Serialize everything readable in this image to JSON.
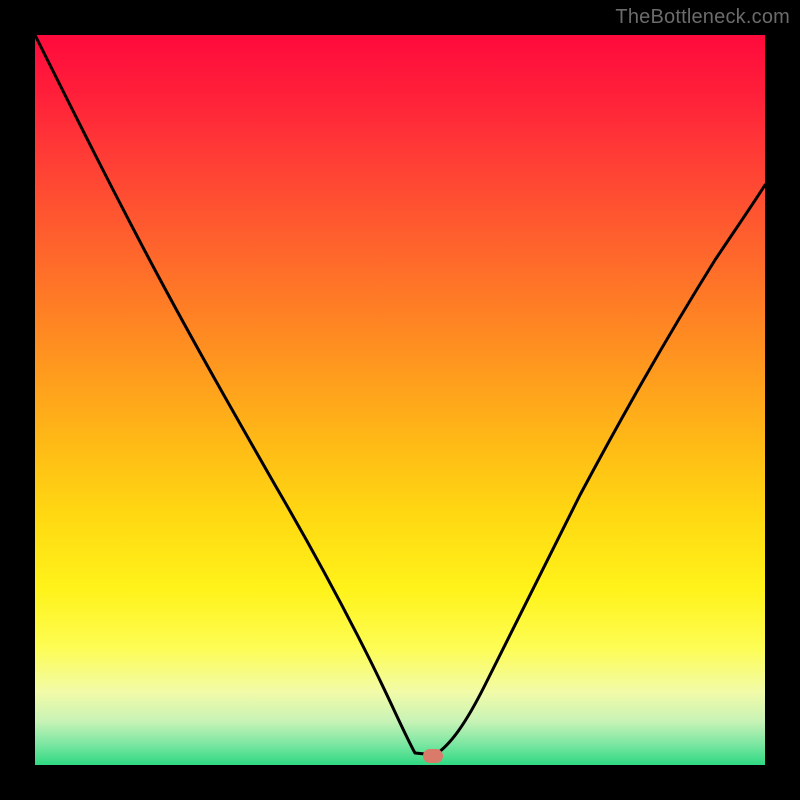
{
  "watermark": "TheBottleneck.com",
  "chart_data": {
    "type": "line",
    "title": "",
    "xlabel": "",
    "ylabel": "",
    "xlim": [
      0,
      100
    ],
    "ylim": [
      0,
      100
    ],
    "background_gradient": {
      "top": "#ff0a3c",
      "bottom": "#2fd983",
      "meaning": "severity scale (red=high, green=low)"
    },
    "series": [
      {
        "name": "bottleneck-curve",
        "color": "#000000",
        "x": [
          0,
          5,
          10,
          15,
          20,
          25,
          30,
          35,
          40,
          45,
          48,
          50,
          52,
          55,
          58,
          62,
          68,
          74,
          80,
          86,
          92,
          100
        ],
        "y": [
          100,
          88,
          77,
          66,
          56,
          46,
          37,
          28,
          19,
          10,
          5,
          2,
          1,
          2,
          5,
          11,
          20,
          30,
          40,
          50,
          60,
          74
        ]
      }
    ],
    "marker": {
      "name": "optimal-point",
      "x": 52,
      "y": 1,
      "color": "#d97a6a",
      "shape": "rounded-rect"
    },
    "grid": false,
    "legend": false
  }
}
